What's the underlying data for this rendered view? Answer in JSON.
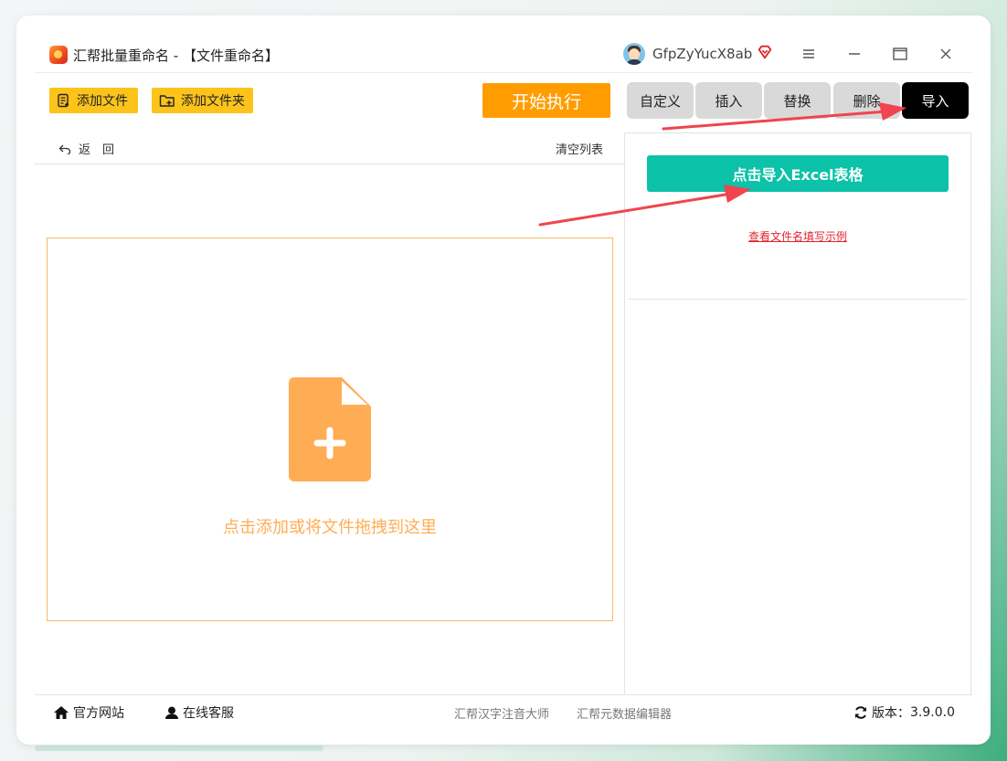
{
  "window": {
    "title": "汇帮批量重命名 - 【文件重命名】",
    "username": "GfpZyYucX8ab"
  },
  "toolbar": {
    "add_file": "添加文件",
    "add_folder": "添加文件夹",
    "start": "开始执行"
  },
  "tabs": [
    {
      "label": "自定义",
      "active": false
    },
    {
      "label": "插入",
      "active": false
    },
    {
      "label": "替换",
      "active": false
    },
    {
      "label": "删除",
      "active": false
    },
    {
      "label": "导入",
      "active": true
    }
  ],
  "left_panel": {
    "back": "返　回",
    "clear": "清空列表",
    "drop_hint": "点击添加或将文件拖拽到这里"
  },
  "right_panel": {
    "import_excel": "点击导入Excel表格",
    "example_link": "查看文件名填写示例"
  },
  "footer": {
    "website": "官方网站",
    "support": "在线客服",
    "link1": "汇帮汉字注音大师",
    "link2": "汇帮元数据编辑器",
    "version_label": "版本：",
    "version": "3.9.0.0"
  },
  "colors": {
    "accent_yellow": "#fcc31b",
    "start_orange": "#ff9d00",
    "teal": "#0cc2a8",
    "drop_orange": "#ffad55",
    "link_red": "#e0242e",
    "arrow_red": "#f0444f"
  }
}
